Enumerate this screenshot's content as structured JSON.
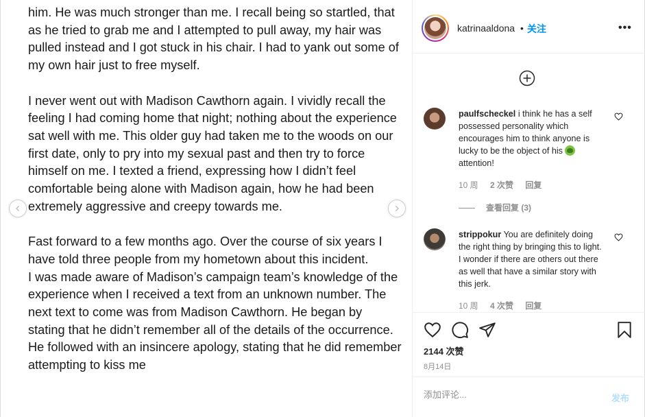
{
  "post_text": {
    "paragraphs": [
      "him. He was much stronger than me. I recall being so startled, that as he tried to grab me and I attempted to pull away, my hair was pulled instead and I got stuck in his chair. I had to yank out some of my own hair just to free myself.",
      "I never went out with Madison Cawthorn again. I vividly recall the feeling I had coming home that night; nothing about the experience sat well with me. This older guy had taken me to the woods on our first date, only to pry into my sexual past and then try to force himself on me. I texted a friend, expressing how I didn’t feel comfortable being alone with Madison again, how he had been extremely aggressive and creepy towards me.",
      "Fast forward to a few months ago. Over the course of six years I have told three people from my hometown about this incident.",
      "I was made aware of Madison’s campaign team’s knowledge of the experience when I received a text from an unknown number. The next text to come was from Madison Cawthorn. He began by stating that he didn’t remember all of the details of the occurrence. He followed with an insincere apology, stating that he did remember attempting to kiss me"
    ]
  },
  "header": {
    "username": "katrinaaldona",
    "separator": "•",
    "follow_label": "关注",
    "more_label": "•••"
  },
  "comments": [
    {
      "user": "paulfscheckel",
      "text": "i think he has a self possessed personality which encourages him to think anyone is lucky to be the object of his",
      "text_after_emoji": "attention!",
      "emoji": "nauseated-face",
      "time": "10 周",
      "likes": "2 次赞",
      "reply": "回复",
      "view_replies": "查看回复 (3)"
    },
    {
      "user": "strippokur",
      "text": "You are definitely doing the right thing by bringing this to light. I wonder if there are others out there as well that have a similar story with this jerk.",
      "time": "10 周",
      "likes": "4 次赞",
      "reply": "回复"
    }
  ],
  "actions": {
    "likes_count": "2144 次赞",
    "date": "8月14日"
  },
  "add_comment": {
    "placeholder": "添加评论...",
    "post_label": "发布"
  },
  "colors": {
    "accent": "#0095f6",
    "muted": "#8e8e8e",
    "post_disabled": "#b2dffc",
    "border": "#efefef"
  }
}
